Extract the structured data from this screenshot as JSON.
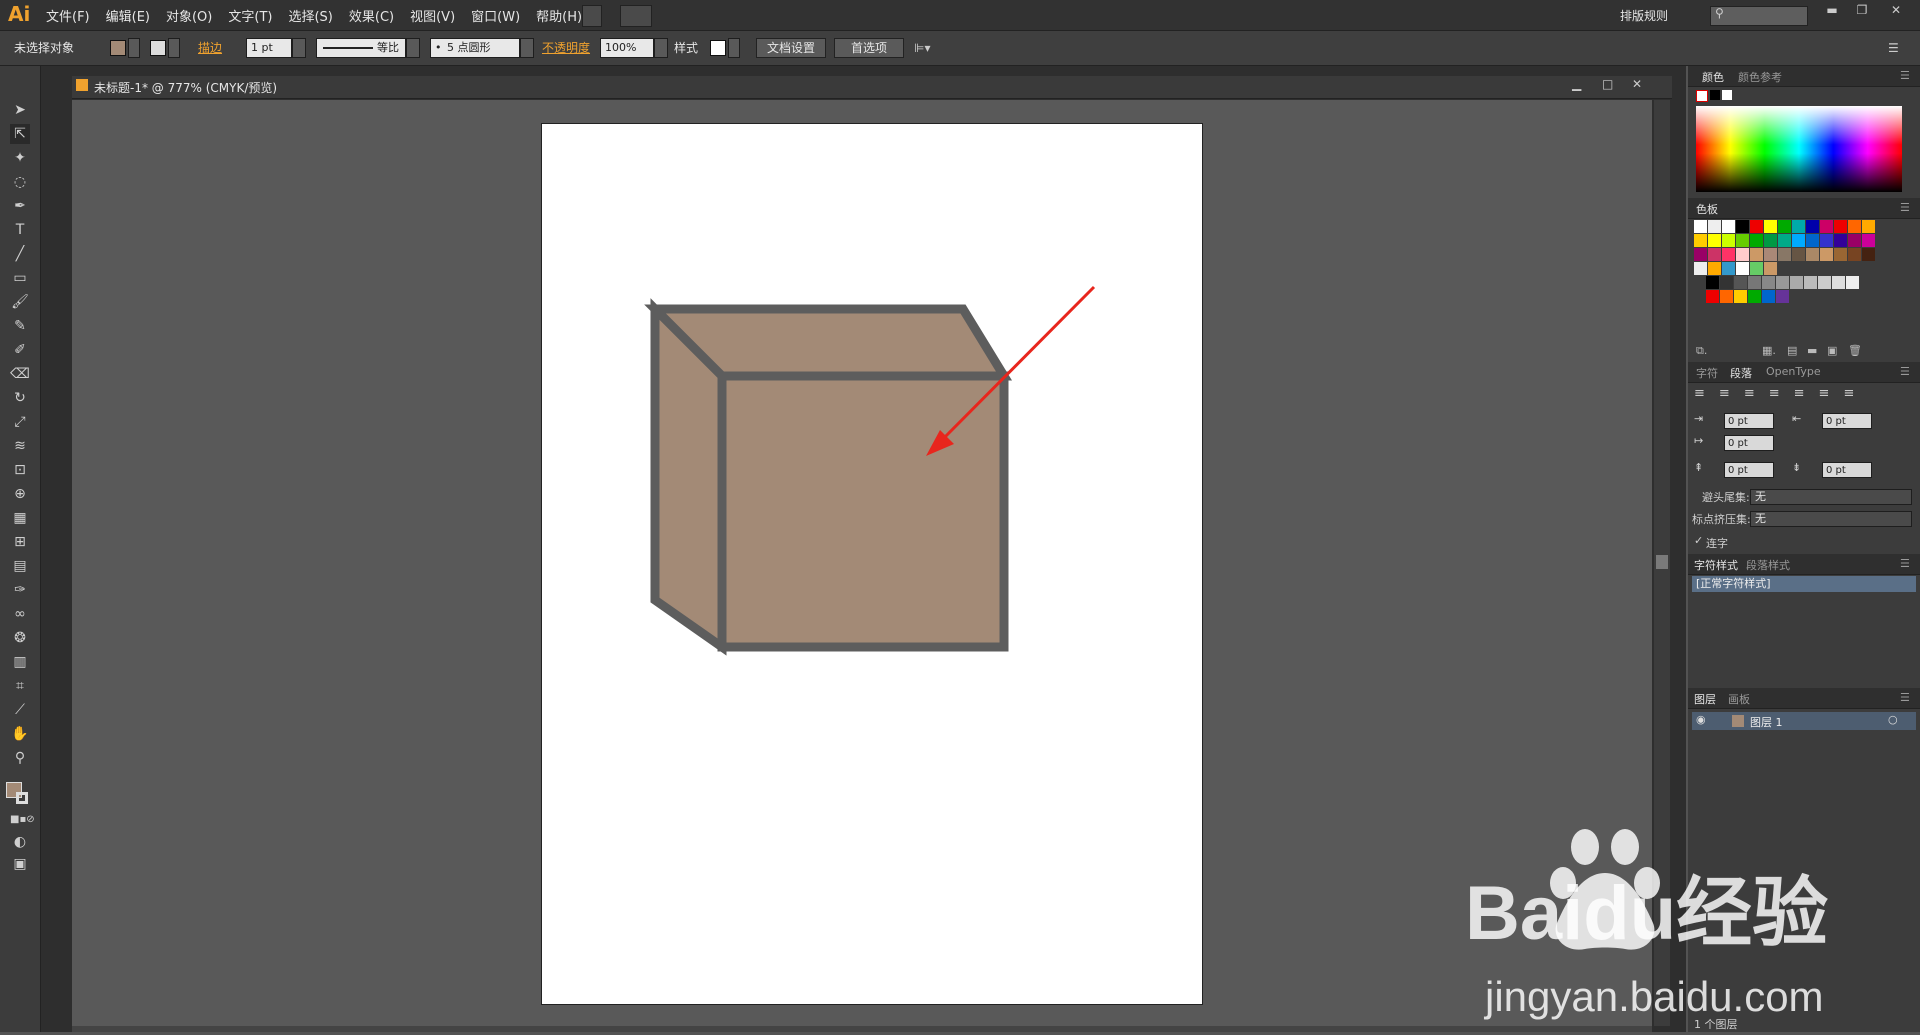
{
  "app": {
    "logo_text": "Ai"
  },
  "menu": {
    "items": [
      "文件(F)",
      "编辑(E)",
      "对象(O)",
      "文字(T)",
      "选择(S)",
      "效果(C)",
      "视图(V)",
      "窗口(W)",
      "帮助(H)"
    ],
    "workspace_label": "排版规则"
  },
  "controlbar": {
    "selection_status": "未选择对象",
    "stroke_label": "描边",
    "stroke_weight": "1 pt",
    "stroke_profile": "等比",
    "brush": "5 点圆形",
    "opacity_label": "不透明度",
    "opacity_value": "100%",
    "style_label": "样式",
    "doc_setup_button": "文档设置",
    "preferences_button": "首选项"
  },
  "document": {
    "tab_title": "未标题-1* @ 777% (CMYK/预览)",
    "cube_fill_color": "#a38a76",
    "cube_stroke_color": "#5d5d5d",
    "arrow_color": "#e8261d"
  },
  "panels": {
    "color": {
      "tabs": [
        "颜色",
        "颜色参考"
      ]
    },
    "swatches": {
      "tab": "色板"
    },
    "character": {
      "tabs": [
        "字符",
        "段落",
        "OpenType"
      ],
      "indent_left": "0 pt",
      "indent_right": "0 pt",
      "first_line": "0 pt",
      "space_before": "0 pt",
      "space_after": "0 pt",
      "kinsoku_label": "避头尾集:",
      "kinsoku_value": "无",
      "mojikumi_label": "标点挤压集:",
      "mojikumi_value": "无",
      "hyphen_label": "连字"
    },
    "char_styles": {
      "tabs": [
        "字符样式",
        "段落样式"
      ],
      "item": "[正常字符样式]"
    },
    "layers": {
      "tabs": [
        "图层",
        "画板"
      ],
      "layer_name": "图层 1",
      "count": "1 个图层"
    }
  },
  "watermark": {
    "brand": "Baidu经验",
    "url": "jingyan.baidu.com"
  }
}
